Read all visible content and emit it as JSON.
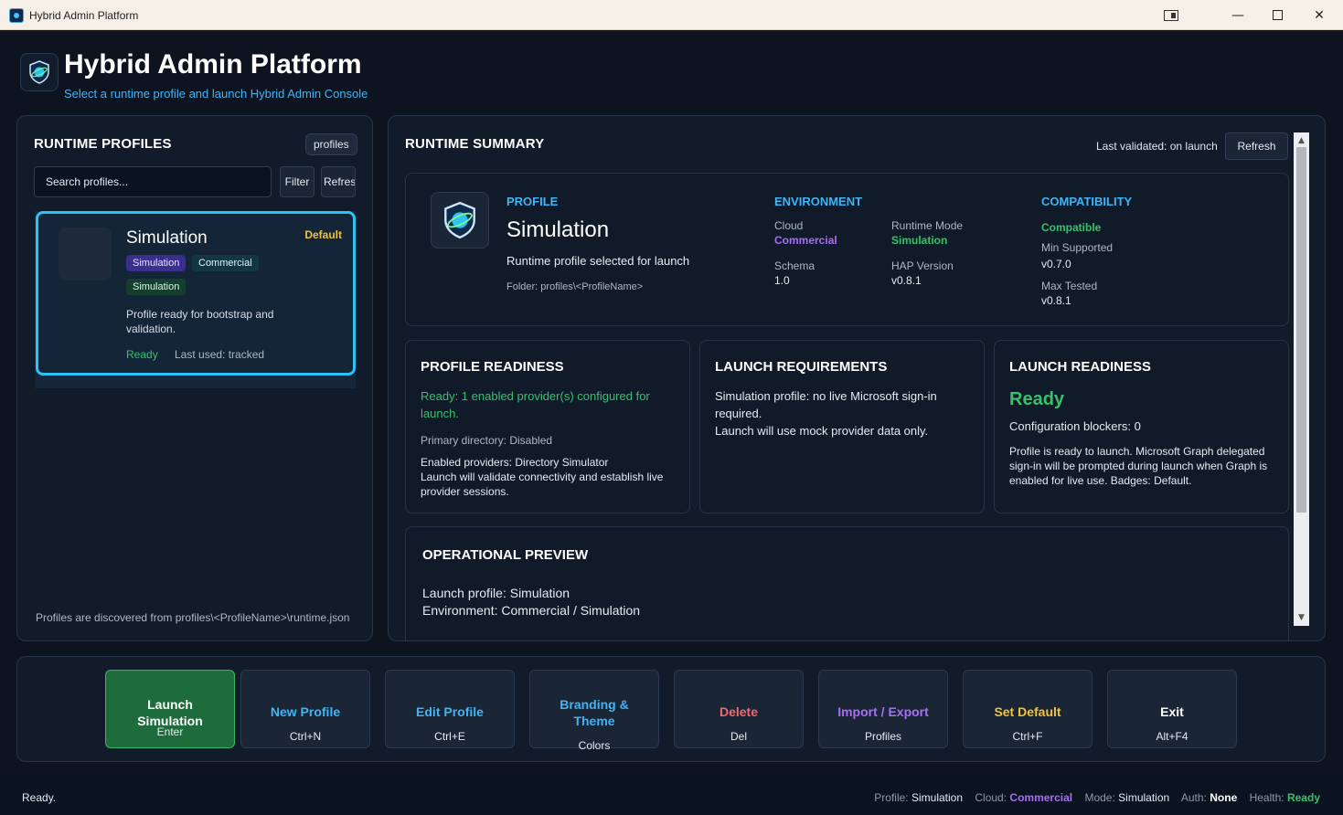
{
  "window": {
    "title": "Hybrid Admin Platform"
  },
  "header": {
    "title": "Hybrid Admin Platform",
    "subtitle": "Select a runtime profile and launch Hybrid Admin Console"
  },
  "left": {
    "title": "RUNTIME PROFILES",
    "chip": "profiles",
    "search_placeholder": "Search profiles...",
    "filter_label": "Filter",
    "refresh_label": "Refresh",
    "card": {
      "name": "Simulation",
      "default_label": "Default",
      "tags": [
        "Simulation",
        "Commercial",
        "Simulation"
      ],
      "description": "Profile ready for bootstrap and validation.",
      "status": "Ready",
      "last_used": "Last used: tracked"
    },
    "footer": "Profiles are discovered from profiles\\<ProfileName>\\runtime.json"
  },
  "right": {
    "title": "RUNTIME SUMMARY",
    "last_validated": "Last validated: on launch",
    "refresh_label": "Refresh",
    "profile": {
      "heading": "PROFILE",
      "name": "Simulation",
      "subtitle": "Runtime profile selected for launch",
      "folder": "Folder: profiles\\<ProfileName>"
    },
    "environment": {
      "heading": "ENVIRONMENT",
      "cloud_label": "Cloud",
      "cloud_value": "Commercial",
      "runtime_mode_label": "Runtime Mode",
      "runtime_mode_value": "Simulation",
      "schema_label": "Schema",
      "schema_value": "1.0",
      "hap_label": "HAP Version",
      "hap_value": "v0.8.1"
    },
    "compatibility": {
      "heading": "COMPATIBILITY",
      "status": "Compatible",
      "min_label": "Min Supported",
      "min_value": "v0.7.0",
      "max_label": "Max Tested",
      "max_value": "v0.8.1"
    },
    "profile_readiness": {
      "title": "PROFILE READINESS",
      "status": "Ready: 1 enabled provider(s) configured for launch.",
      "primary_directory": "Primary directory: Disabled",
      "providers": "Enabled providers: Directory Simulator",
      "validate": "Launch will validate connectivity and establish live provider sessions."
    },
    "launch_requirements": {
      "title": "LAUNCH REQUIREMENTS",
      "line1": "Simulation profile: no live Microsoft sign-in required.",
      "line2": "Launch will use mock provider data only."
    },
    "launch_readiness": {
      "title": "LAUNCH READINESS",
      "status": "Ready",
      "blockers": "Configuration blockers: 0",
      "detail": "Profile is ready to launch. Microsoft Graph delegated sign-in will be prompted during launch when Graph is enabled for live use. Badges: Default."
    },
    "operational_preview": {
      "title": "OPERATIONAL PREVIEW",
      "line1": "Launch profile: Simulation",
      "line2": "Environment: Commercial / Simulation"
    }
  },
  "actions": [
    {
      "label": "Launch Simulation",
      "key": "Enter"
    },
    {
      "label": "New Profile",
      "key": "Ctrl+N"
    },
    {
      "label": "Edit Profile",
      "key": "Ctrl+E"
    },
    {
      "label": "Branding & Theme",
      "key": "Colors"
    },
    {
      "label": "Delete",
      "key": "Del"
    },
    {
      "label": "Import / Export",
      "key": "Profiles"
    },
    {
      "label": "Set Default",
      "key": "Ctrl+F"
    },
    {
      "label": "Exit",
      "key": "Alt+F4"
    }
  ],
  "status": {
    "left": "Ready.",
    "profile_label": "Profile:",
    "profile_value": "Simulation",
    "cloud_label": "Cloud:",
    "cloud_value": "Commercial",
    "mode_label": "Mode:",
    "mode_value": "Simulation",
    "auth_label": "Auth:",
    "auth_value": "None",
    "health_label": "Health:",
    "health_value": "Ready"
  },
  "colors": {
    "accent_cyan": "#2bc4f2",
    "accent_blue": "#3fb4f6",
    "green": "#35c26b",
    "purple": "#a86ef5",
    "red": "#ef6b6b",
    "yellow": "#f2c23c",
    "launch_bg": "#1e6b3c"
  }
}
